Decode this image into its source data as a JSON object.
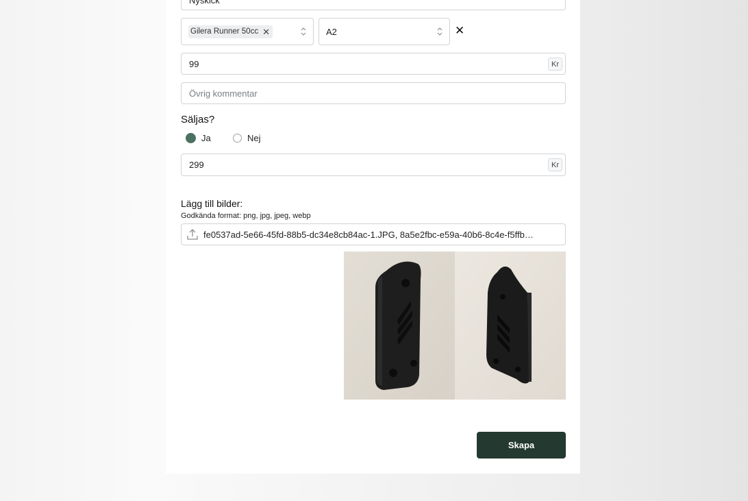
{
  "form": {
    "condition_value": "Nyskick",
    "model_chip": "Gilera Runner 50cc",
    "chip_remove": "✕",
    "variant_value": "A2",
    "clear_symbol": "✕",
    "price_value": "99",
    "currency": "Kr",
    "comment_placeholder": "Övrig kommentar",
    "sell_heading": "Säljas?",
    "sell_options": [
      {
        "label": "Ja",
        "checked": true
      },
      {
        "label": "Nej",
        "checked": false
      }
    ],
    "sell_price_value": "299",
    "images_heading": "Lägg till bilder:",
    "images_hint": "Godkända format: png, jpg, jpeg, webp",
    "files_value": "fe0537ad-5e66-45fd-88b5-dc34e8cb84ac-1.JPG, 8a5e2fbc-e59a-40b6-8c4e-f5ffb…",
    "upload_icon": "upload-icon",
    "submit_label": "Skapa"
  },
  "colors": {
    "accent": "#4d7161",
    "button": "#24392f"
  }
}
